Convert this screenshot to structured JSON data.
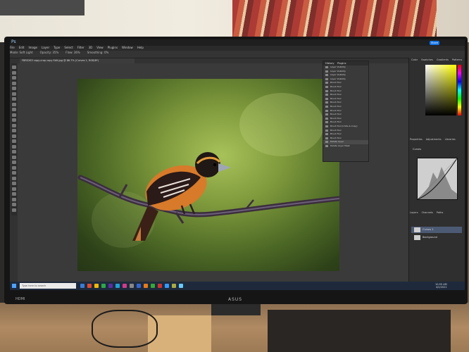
{
  "app": {
    "logo": "Ps",
    "title": "FBR0263 copy-crop copy Edit.jpg @ 66.7% (Curves 1, RGB/8*)",
    "share_label": "Share"
  },
  "menu": [
    "File",
    "Edit",
    "Image",
    "Layer",
    "Type",
    "Select",
    "Filter",
    "3D",
    "View",
    "Plugins",
    "Window",
    "Help"
  ],
  "options_bar": [
    "Mode: Soft Light",
    "Opacity: 35%",
    "Flow: 36%",
    "Smoothing: 0%"
  ],
  "history_panel": {
    "tabs": [
      "History",
      "Plugins"
    ],
    "rows": [
      "Layer Visibility",
      "Layer Visibility",
      "Layer Visibility",
      "Layer Visibility",
      "Brush Tool",
      "Brush Tool",
      "Brush Tool",
      "Brush Tool",
      "Brush Tool",
      "Brush Tool",
      "Brush Tool",
      "Brush Tool",
      "Brush Tool",
      "Brush Tool",
      "Brush Tool",
      "Brush Tool (Unite & Copy)",
      "Brush Tool",
      "Brush Tool",
      "Brush Tool",
      "Delete Layer",
      "Delete Layer Mask"
    ],
    "selected_index": 19
  },
  "right_panel": {
    "color_tabs": [
      "Color",
      "Swatches",
      "Gradients",
      "Patterns"
    ],
    "properties_tabs": [
      "Properties",
      "Adjustments",
      "Libraries"
    ],
    "curves_label": "Curves",
    "layers_tabs": [
      "Layers",
      "Channels",
      "Paths"
    ],
    "layers": [
      {
        "name": "Curves 1",
        "selected": true
      },
      {
        "name": "Background",
        "selected": false
      }
    ]
  },
  "taskbar": {
    "search_placeholder": "Type here to search",
    "time": "10:55 AM",
    "date": "4/2/2021"
  },
  "monitor": {
    "brand": "ASUS",
    "port_label": "HDMI"
  },
  "colors": {
    "ps_blue": "#1473e6",
    "taskbar": "#1e2a3c",
    "bird_orange": "#d77a2a"
  }
}
